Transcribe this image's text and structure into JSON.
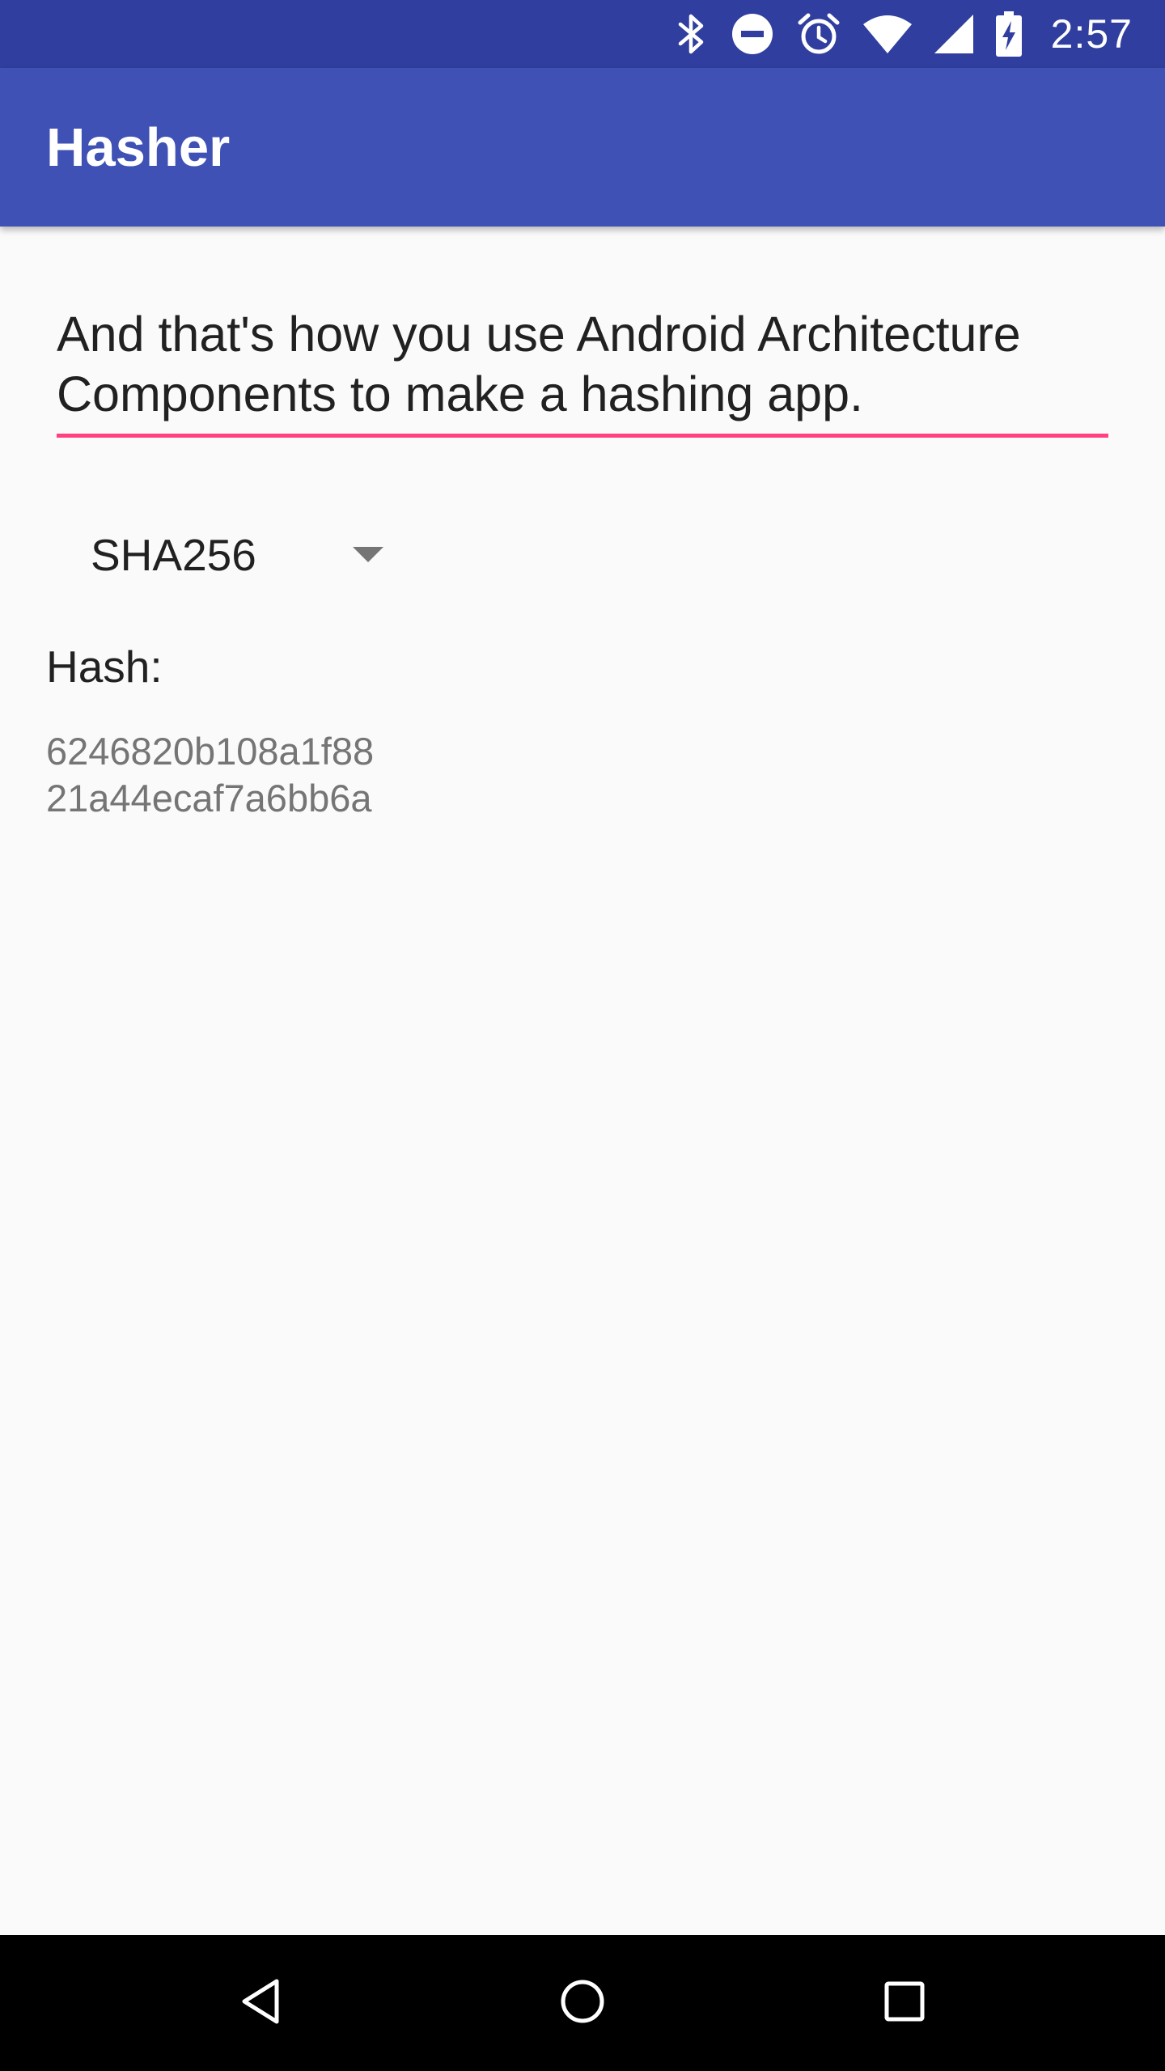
{
  "status_bar": {
    "icons": [
      "bluetooth-icon",
      "do-not-disturb-icon",
      "alarm-icon",
      "wifi-icon",
      "cell-signal-icon",
      "battery-charging-icon"
    ],
    "time": "2:57",
    "background": "#303f9f"
  },
  "app_bar": {
    "title": "Hasher",
    "background": "#3f51b5"
  },
  "input": {
    "value": "And that's how you use Android Architecture Components to make a hashing app.",
    "underline_color": "#ff4081"
  },
  "algorithm_spinner": {
    "selected": "SHA256",
    "icon": "dropdown-arrow-icon"
  },
  "result": {
    "label": "Hash:",
    "value": "6246820b108a1f88\n21a44ecaf7a6bb6a"
  },
  "nav_bar": {
    "buttons": [
      "back-icon",
      "home-icon",
      "recents-icon"
    ]
  }
}
